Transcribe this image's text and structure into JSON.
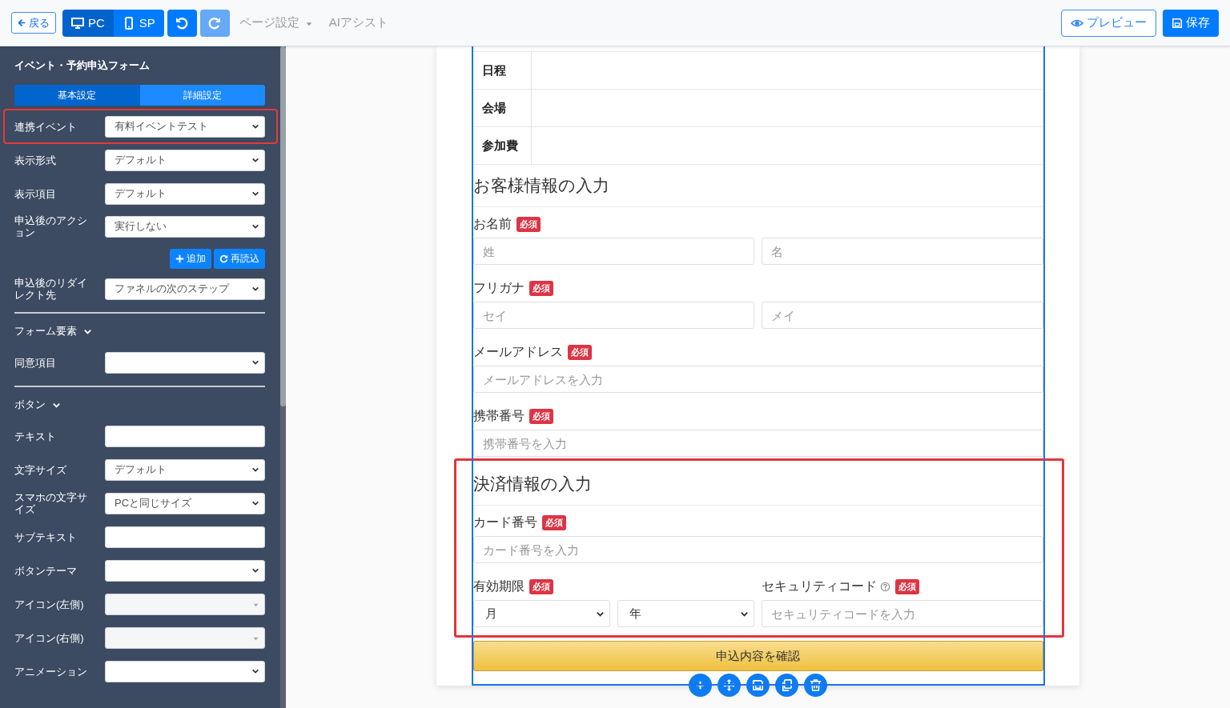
{
  "toolbar": {
    "back": "戻る",
    "devices": [
      {
        "label": "PC",
        "kind": "desktop",
        "selected": true
      },
      {
        "label": "SP",
        "kind": "mobile",
        "selected": false
      }
    ],
    "history": [
      {
        "kind": "undo",
        "disabled": false
      },
      {
        "kind": "redo",
        "disabled": true
      }
    ],
    "menus": [
      {
        "label": "ページ設定",
        "dropdown": true
      },
      {
        "label": "AIアシスト",
        "dropdown": false
      }
    ],
    "preview": "プレビュー",
    "save": "保存"
  },
  "sidebar": {
    "title": "イベント・予約申込フォーム",
    "tabs": [
      {
        "label": "基本設定",
        "selected": true
      },
      {
        "label": "詳細設定",
        "selected": false
      }
    ],
    "sections": [
      {
        "rows": [
          {
            "label": "連携イベント",
            "kind": "select",
            "value": "有料イベントテスト",
            "highlighted": true
          },
          {
            "label": "表示形式",
            "kind": "select",
            "value": "デフォルト",
            "highlighted": false
          },
          {
            "label": "表示項目",
            "kind": "select",
            "value": "デフォルト",
            "highlighted": false
          },
          {
            "label": "申込後のアクション",
            "kind": "select",
            "value": "実行しない",
            "highlighted": false,
            "actions": [
              {
                "kind": "add",
                "label": "追加"
              },
              {
                "kind": "reload",
                "label": "再読込"
              }
            ]
          },
          {
            "label": "申込後のリダイレクト先",
            "kind": "select",
            "value": "ファネルの次のステップ",
            "highlighted": false
          }
        ]
      },
      {
        "heading": "フォーム要素",
        "expanded": true,
        "rows": [
          {
            "label": "同意項目",
            "kind": "select",
            "highlighted": false
          }
        ]
      },
      {
        "heading": "ボタン",
        "expanded": true,
        "rows": [
          {
            "label": "テキスト",
            "kind": "text",
            "highlighted": false
          },
          {
            "label": "文字サイズ",
            "kind": "select",
            "value": "デフォルト",
            "highlighted": false
          },
          {
            "label": "スマホの文字サイズ",
            "kind": "select",
            "value": "PCと同じサイズ",
            "highlighted": false
          },
          {
            "label": "サブテキスト",
            "kind": "text",
            "highlighted": false
          },
          {
            "label": "ボタンテーマ",
            "kind": "select",
            "highlighted": false
          },
          {
            "label": "アイコン(左側)",
            "kind": "picker",
            "highlighted": false
          },
          {
            "label": "アイコン(右側)",
            "kind": "picker",
            "highlighted": false
          },
          {
            "label": "アニメーション",
            "kind": "select",
            "highlighted": false
          }
        ]
      }
    ]
  },
  "form": {
    "info_table": [
      {
        "label": "日程"
      },
      {
        "label": "会場"
      },
      {
        "label": "参加費"
      }
    ],
    "sections": [
      {
        "heading": "お客様情報の入力",
        "highlighted": false,
        "fields": [
          {
            "label": "お名前",
            "badge": "必須",
            "inputs": [
              {
                "kind": "text",
                "placeholder": "姓"
              },
              {
                "kind": "text",
                "placeholder": "名"
              }
            ]
          },
          {
            "label": "フリガナ",
            "badge": "必須",
            "inputs": [
              {
                "kind": "text",
                "placeholder": "セイ"
              },
              {
                "kind": "text",
                "placeholder": "メイ"
              }
            ]
          },
          {
            "label": "メールアドレス",
            "badge": "必須",
            "inputs": [
              {
                "kind": "text",
                "placeholder": "メールアドレスを入力"
              }
            ]
          },
          {
            "label": "携帯番号",
            "badge": "必須",
            "inputs": [
              {
                "kind": "text",
                "placeholder": "携帯番号を入力"
              }
            ]
          }
        ]
      },
      {
        "heading": "決済情報の入力",
        "highlighted": true,
        "fields": [
          {
            "label": "カード番号",
            "badge": "必須",
            "inputs": [
              {
                "kind": "text",
                "placeholder": "カード番号を入力"
              }
            ]
          },
          {
            "columns": [
              {
                "label": "有効期限",
                "badge": "必須",
                "inputs": [
                  {
                    "kind": "select",
                    "value": "月"
                  },
                  {
                    "kind": "select",
                    "value": "年"
                  }
                ]
              },
              {
                "label": "セキュリティコード",
                "badge": "必須",
                "help": true,
                "inputs": [
                  {
                    "kind": "text",
                    "placeholder": "セキュリティコードを入力"
                  }
                ]
              }
            ]
          }
        ]
      }
    ],
    "submit": "申込内容を確認",
    "block_tools": [
      {
        "kind": "add"
      },
      {
        "kind": "move"
      },
      {
        "kind": "save"
      },
      {
        "kind": "copy"
      },
      {
        "kind": "delete"
      }
    ]
  }
}
